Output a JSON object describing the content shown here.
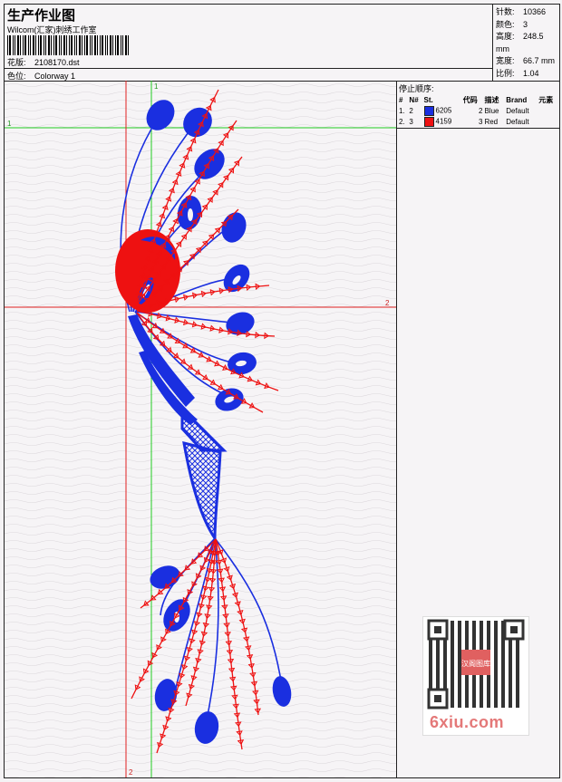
{
  "header": {
    "title": "生产作业图",
    "studio": "Wilcom(汇家)刺绣工作室",
    "design_label": "花版:",
    "design_file": "2108170.dst",
    "color_label": "色位:",
    "colorway": "Colorway 1"
  },
  "stats": [
    {
      "label": "针数:",
      "value": "10366"
    },
    {
      "label": "颜色:",
      "value": "3"
    },
    {
      "label": "高度:",
      "value": "248.5 mm"
    },
    {
      "label": "宽度:",
      "value": "66.7 mm"
    },
    {
      "label": "比例:",
      "value": "1.04"
    }
  ],
  "stop_sequence": {
    "title": "停止顺序:",
    "columns": [
      "#",
      "N#",
      "St.",
      "代码",
      "描述",
      "Brand",
      "元素"
    ],
    "rows": [
      {
        "num": "1.",
        "n": "2",
        "color": "#1a2fe0",
        "st": "6205",
        "code": "2",
        "desc": "Blue",
        "brand": "Default",
        "element": ""
      },
      {
        "num": "2.",
        "n": "3",
        "color": "#ee1111",
        "st": "4159",
        "code": "3",
        "desc": "Red",
        "brand": "Default",
        "element": ""
      }
    ]
  },
  "axes": {
    "v1": "1",
    "h1": "1",
    "h2": "2",
    "v2": "2"
  },
  "colors": {
    "blue": "#1a2fe0",
    "red": "#ee1111",
    "green_axis": "#22cc22",
    "red_axis": "#e02020"
  },
  "watermark": "6xiu.com",
  "qr_badge": "汉阁图库"
}
